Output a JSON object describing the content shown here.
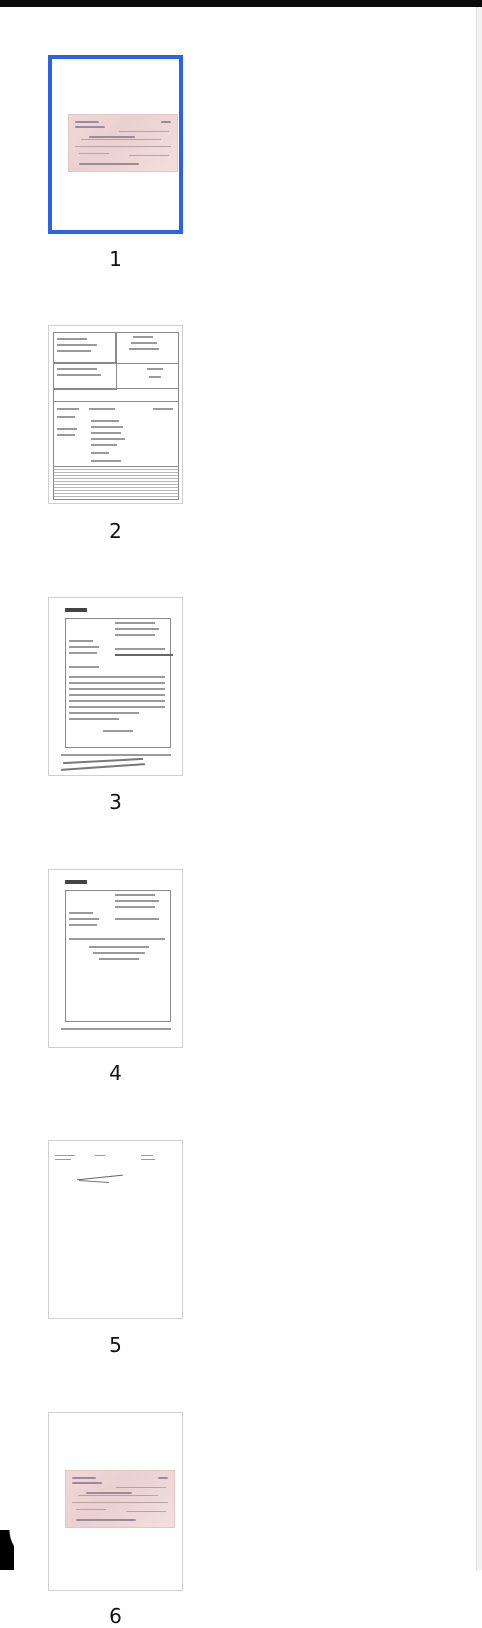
{
  "thumbnails": [
    {
      "number": "1",
      "selected": true
    },
    {
      "number": "2",
      "selected": false
    },
    {
      "number": "3",
      "selected": false
    },
    {
      "number": "4",
      "selected": false
    },
    {
      "number": "5",
      "selected": false
    },
    {
      "number": "6",
      "selected": false
    }
  ],
  "colors": {
    "selection": "#2b63e6",
    "check_tint": "#f1d8d8"
  }
}
